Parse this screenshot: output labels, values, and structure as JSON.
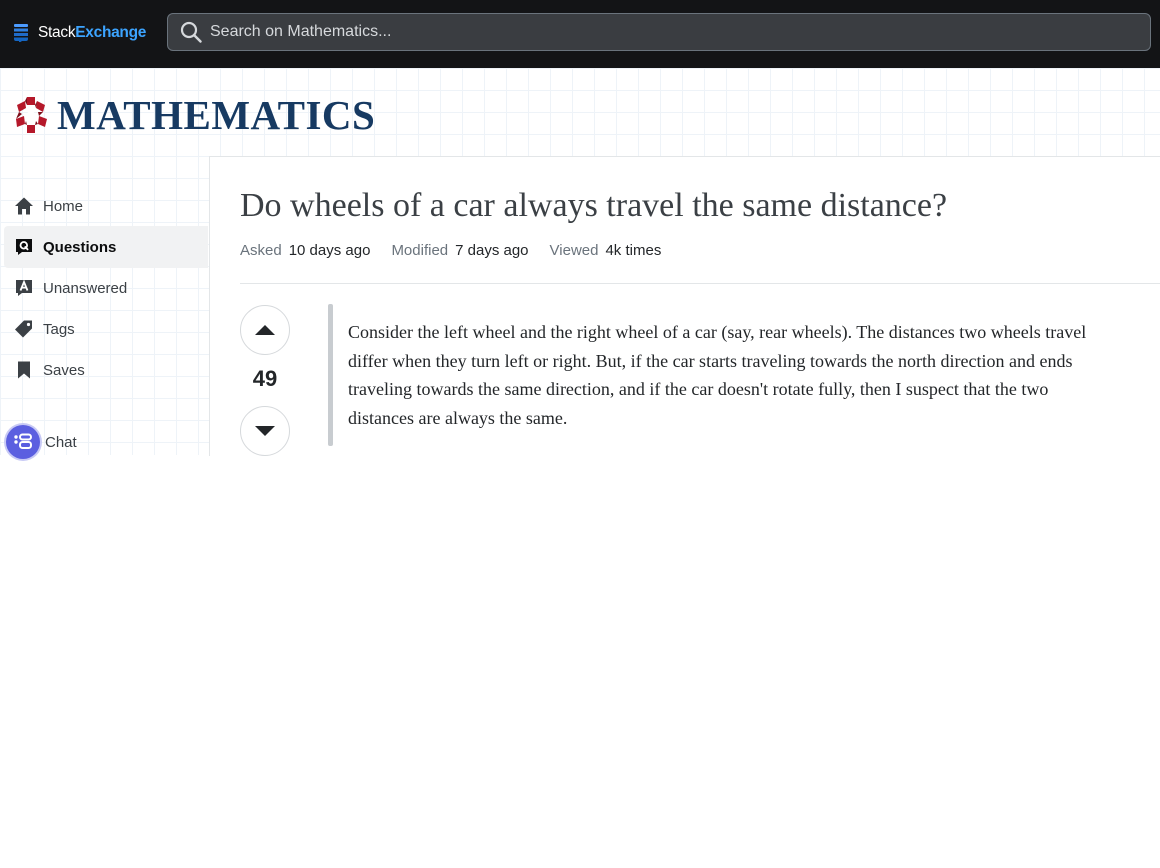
{
  "topbar": {
    "logo_stack": "Stack",
    "logo_exchange": "Exchange",
    "search_placeholder": "Search on Mathematics..."
  },
  "site": {
    "name": "MATHEMATICS"
  },
  "sidebar": {
    "items": [
      {
        "label": "Home",
        "icon": "home-icon",
        "active": false
      },
      {
        "label": "Questions",
        "icon": "questions-icon",
        "active": true
      },
      {
        "label": "Unanswered",
        "icon": "unanswered-icon",
        "active": false
      },
      {
        "label": "Tags",
        "icon": "tag-icon",
        "active": false
      },
      {
        "label": "Saves",
        "icon": "bookmark-icon",
        "active": false
      }
    ],
    "chat_label": "Chat"
  },
  "question": {
    "title": "Do wheels of a car always travel the same distance?",
    "meta": {
      "asked_label": "Asked",
      "asked_value": "10 days ago",
      "modified_label": "Modified",
      "modified_value": "7 days ago",
      "viewed_label": "Viewed",
      "viewed_value": "4k times"
    },
    "votes": "49",
    "body": "Consider the left wheel and the right wheel of a car (say, rear wheels). The distances two wheels travel differ when they turn left or right. But, if the car starts traveling towards the north direction and ends traveling towards the same direction, and if the car doesn't rotate fully, then I suspect that the two distances are always the same."
  },
  "colors": {
    "topbar_bg": "#131416",
    "brand_exchange": "#3ca4ff",
    "site_name": "#173a62",
    "math_logo": "#b5182a",
    "chat_accent": "#5b5fe0"
  }
}
